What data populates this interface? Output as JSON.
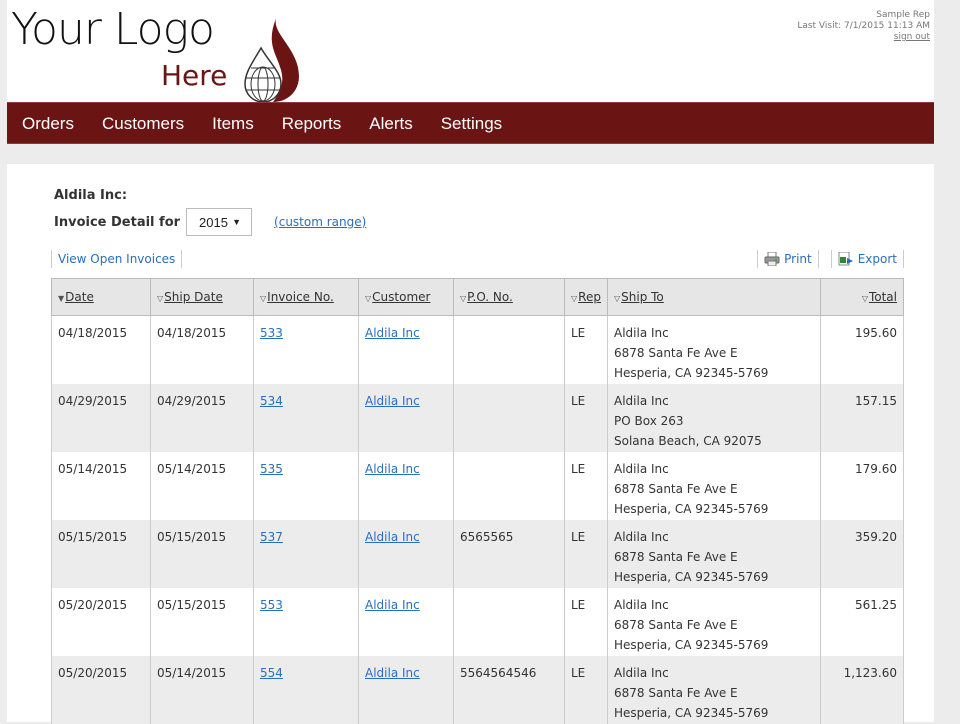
{
  "logo": {
    "line1": "Your Logo",
    "line2": "Here"
  },
  "user": {
    "name": "Sample Rep",
    "last_visit": "Last Visit: 7/1/2015 11:13 AM",
    "sign_out": "sign out"
  },
  "nav": {
    "items": [
      "Orders",
      "Customers",
      "Items",
      "Reports",
      "Alerts",
      "Settings"
    ]
  },
  "colors": {
    "brand": "#6a1414",
    "link": "#2a6ebb"
  },
  "page": {
    "customer_name": "Aldila Inc:",
    "detail_label": "Invoice Detail for",
    "year_selected": "2015",
    "custom_range": "(custom range)"
  },
  "toolbar": {
    "view_open": "View Open Invoices",
    "print": "Print",
    "export": "Export"
  },
  "table": {
    "sort_glyph": "▼",
    "sort_glyph_inactive": "▽",
    "headers": [
      "Date",
      "Ship Date",
      "Invoice No.",
      "Customer",
      "P.O. No.",
      "Rep",
      "Ship To",
      "Total"
    ],
    "rows": [
      {
        "date": "04/18/2015",
        "ship_date": "04/18/2015",
        "invoice": "533",
        "customer": "Aldila Inc",
        "po": "",
        "rep": "LE",
        "ship_to": [
          "Aldila Inc",
          "6878 Santa Fe Ave E",
          "Hesperia, CA 92345-5769"
        ],
        "total": "195.60"
      },
      {
        "date": "04/29/2015",
        "ship_date": "04/29/2015",
        "invoice": "534",
        "customer": "Aldila Inc",
        "po": "",
        "rep": "LE",
        "ship_to": [
          "Aldila Inc",
          "PO Box 263",
          "Solana Beach, CA 92075"
        ],
        "total": "157.15"
      },
      {
        "date": "05/14/2015",
        "ship_date": "05/14/2015",
        "invoice": "535",
        "customer": "Aldila Inc",
        "po": "",
        "rep": "LE",
        "ship_to": [
          "Aldila Inc",
          "6878 Santa Fe Ave E",
          "Hesperia, CA 92345-5769"
        ],
        "total": "179.60"
      },
      {
        "date": "05/15/2015",
        "ship_date": "05/15/2015",
        "invoice": "537",
        "customer": "Aldila Inc",
        "po": "6565565",
        "rep": "LE",
        "ship_to": [
          "Aldila Inc",
          "6878 Santa Fe Ave E",
          "Hesperia, CA 92345-5769"
        ],
        "total": "359.20"
      },
      {
        "date": "05/20/2015",
        "ship_date": "05/15/2015",
        "invoice": "553",
        "customer": "Aldila Inc",
        "po": "",
        "rep": "LE",
        "ship_to": [
          "Aldila Inc",
          "6878 Santa Fe Ave E",
          "Hesperia, CA 92345-5769"
        ],
        "total": "561.25"
      },
      {
        "date": "05/20/2015",
        "ship_date": "05/14/2015",
        "invoice": "554",
        "customer": "Aldila Inc",
        "po": "5564564546",
        "rep": "LE",
        "ship_to": [
          "Aldila Inc",
          "6878 Santa Fe Ave E",
          "Hesperia, CA 92345-5769"
        ],
        "total": "1,123.60"
      }
    ]
  }
}
